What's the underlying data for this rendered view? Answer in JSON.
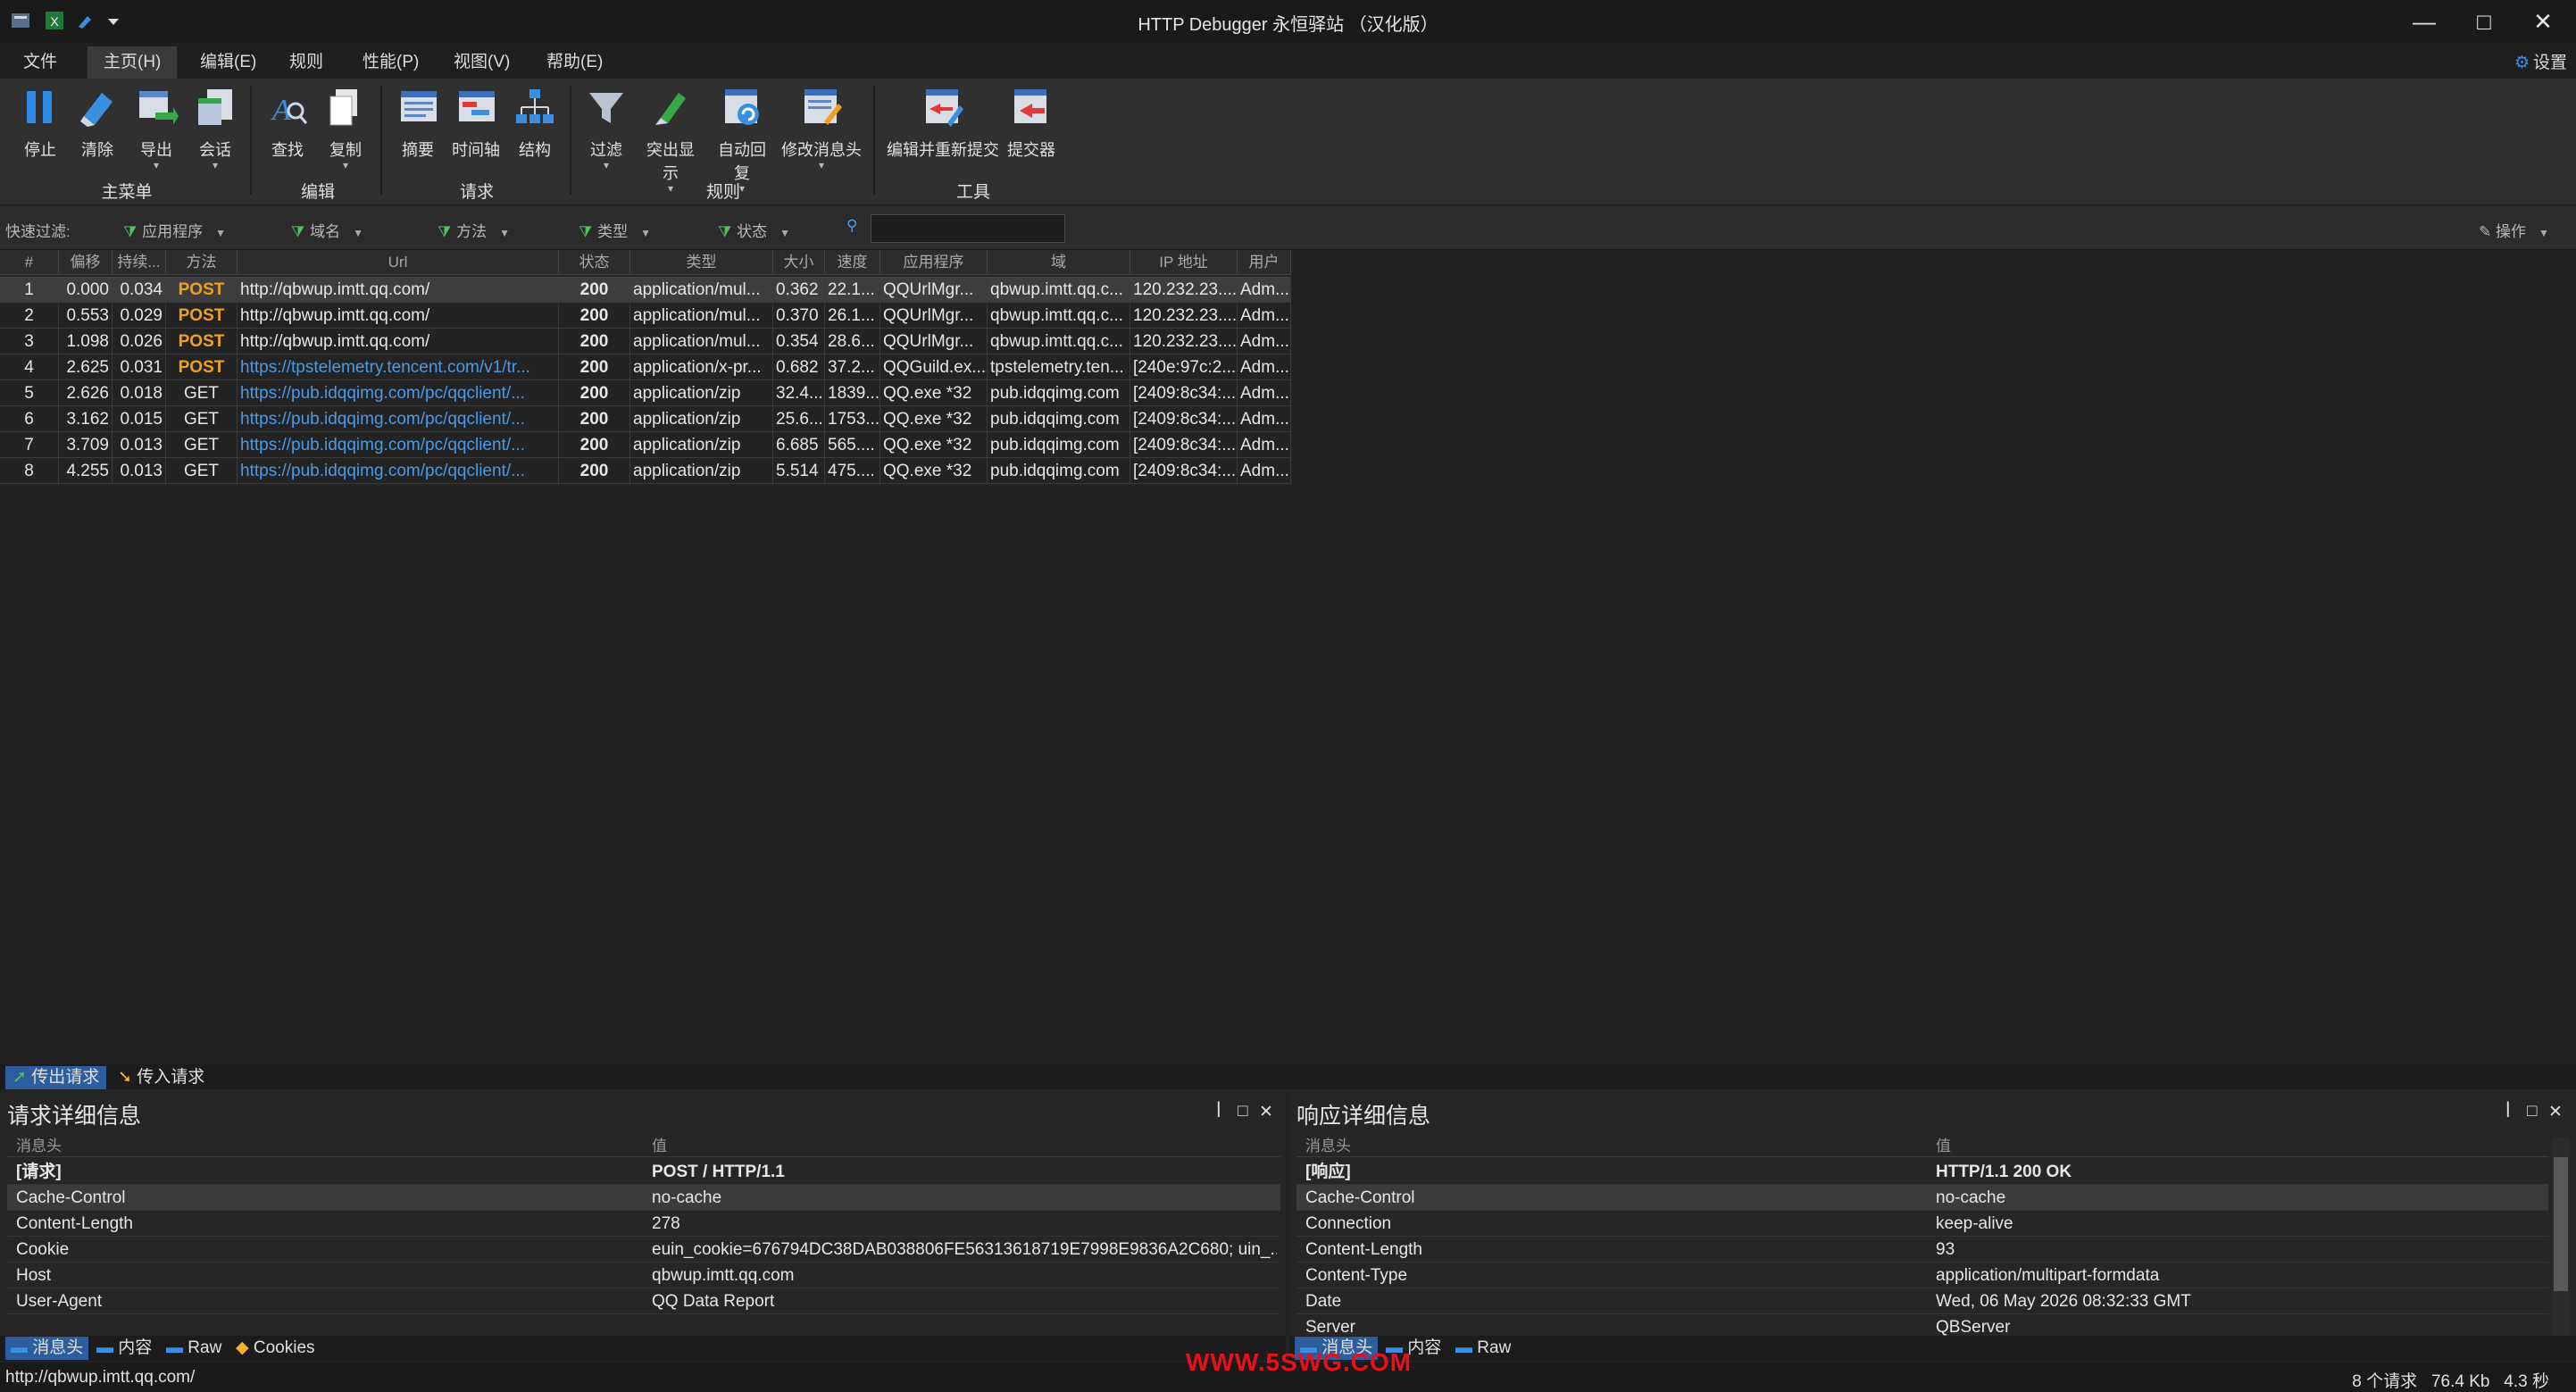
{
  "window": {
    "title": "HTTP Debugger 永恒驿站 （汉化版）",
    "minimize": "—",
    "maximize": "□",
    "close": "✕"
  },
  "menu": {
    "tabs": [
      "文件",
      "主页(H)",
      "编辑(E)",
      "规则",
      "性能(P)",
      "视图(V)",
      "帮助(E)"
    ],
    "active": "主页(H)",
    "settings": "设置"
  },
  "ribbon": {
    "buttons": {
      "stop": "停止",
      "clear": "清除",
      "export": "导出",
      "session": "会话",
      "find": "查找",
      "copy": "复制",
      "summary": "摘要",
      "timeline": "时间轴",
      "structure": "结构",
      "filter": "过滤",
      "highlight": "突出显示",
      "autoreply": "自动回复",
      "modify_headers": "修改消息头",
      "edit_resubmit": "编辑并重新提交",
      "submitter": "提交器"
    },
    "groups": {
      "main": "主菜单",
      "edit": "编辑",
      "request": "请求",
      "rules": "规则",
      "tools": "工具"
    }
  },
  "filterbar": {
    "label": "快速过滤:",
    "app": "应用程序",
    "domain": "域名",
    "method": "方法",
    "type": "类型",
    "status": "状态",
    "search_value": "",
    "operations": "操作"
  },
  "grid": {
    "columns": [
      "#",
      "偏移",
      "持续...",
      "方法",
      "Url",
      "状态",
      "类型",
      "大小",
      "速度",
      "应用程序",
      "域",
      "IP 地址",
      "用户"
    ],
    "rows": [
      {
        "n": "1",
        "offset": "0.000",
        "dur": "0.034",
        "method": "POST",
        "url": "http://qbwup.imtt.qq.com/",
        "status": "200",
        "type": "application/mul...",
        "size": "0.362",
        "speed": "22.1...",
        "app": "QQUrlMgr...",
        "domain": "qbwup.imtt.qq.c...",
        "ip": "120.232.23....",
        "user": "Adm..."
      },
      {
        "n": "2",
        "offset": "0.553",
        "dur": "0.029",
        "method": "POST",
        "url": "http://qbwup.imtt.qq.com/",
        "status": "200",
        "type": "application/mul...",
        "size": "0.370",
        "speed": "26.1...",
        "app": "QQUrlMgr...",
        "domain": "qbwup.imtt.qq.c...",
        "ip": "120.232.23....",
        "user": "Adm..."
      },
      {
        "n": "3",
        "offset": "1.098",
        "dur": "0.026",
        "method": "POST",
        "url": "http://qbwup.imtt.qq.com/",
        "status": "200",
        "type": "application/mul...",
        "size": "0.354",
        "speed": "28.6...",
        "app": "QQUrlMgr...",
        "domain": "qbwup.imtt.qq.c...",
        "ip": "120.232.23....",
        "user": "Adm..."
      },
      {
        "n": "4",
        "offset": "2.625",
        "dur": "0.031",
        "method": "POST",
        "url": "https://tpstelemetry.tencent.com/v1/tr...",
        "status": "200",
        "type": "application/x-pr...",
        "size": "0.682",
        "speed": "37.2...",
        "app": "QQGuild.ex...",
        "domain": "tpstelemetry.ten...",
        "ip": "[240e:97c:2...",
        "user": "Adm..."
      },
      {
        "n": "5",
        "offset": "2.626",
        "dur": "0.018",
        "method": "GET",
        "url": "https://pub.idqqimg.com/pc/qqclient/...",
        "status": "200",
        "type": "application/zip",
        "size": "32.4...",
        "speed": "1839...",
        "app": "QQ.exe *32",
        "domain": "pub.idqqimg.com",
        "ip": "[2409:8c34:...",
        "user": "Adm..."
      },
      {
        "n": "6",
        "offset": "3.162",
        "dur": "0.015",
        "method": "GET",
        "url": "https://pub.idqqimg.com/pc/qqclient/...",
        "status": "200",
        "type": "application/zip",
        "size": "25.6...",
        "speed": "1753...",
        "app": "QQ.exe *32",
        "domain": "pub.idqqimg.com",
        "ip": "[2409:8c34:...",
        "user": "Adm..."
      },
      {
        "n": "7",
        "offset": "3.709",
        "dur": "0.013",
        "method": "GET",
        "url": "https://pub.idqqimg.com/pc/qqclient/...",
        "status": "200",
        "type": "application/zip",
        "size": "6.685",
        "speed": "565....",
        "app": "QQ.exe *32",
        "domain": "pub.idqqimg.com",
        "ip": "[2409:8c34:...",
        "user": "Adm..."
      },
      {
        "n": "8",
        "offset": "4.255",
        "dur": "0.013",
        "method": "GET",
        "url": "https://pub.idqqimg.com/pc/qqclient/...",
        "status": "200",
        "type": "application/zip",
        "size": "5.514",
        "speed": "475....",
        "app": "QQ.exe *32",
        "domain": "pub.idqqimg.com",
        "ip": "[2409:8c34:...",
        "user": "Adm..."
      }
    ]
  },
  "traffic_tabs": {
    "outgoing": "传出请求",
    "incoming": "传入请求"
  },
  "request_panel": {
    "title": "请求详细信息",
    "col_key": "消息头",
    "col_value": "值",
    "rows": [
      {
        "k": "[请求]",
        "v": "POST / HTTP/1.1"
      },
      {
        "k": "Cache-Control",
        "v": "no-cache"
      },
      {
        "k": "Content-Length",
        "v": "278"
      },
      {
        "k": "Cookie",
        "v": "euin_cookie=676794DC38DAB038806FE56313618719E7998E9836A2C680; uin_..."
      },
      {
        "k": "Host",
        "v": "qbwup.imtt.qq.com"
      },
      {
        "k": "User-Agent",
        "v": "QQ Data Report"
      }
    ],
    "tabs": [
      "消息头",
      "内容",
      "Raw",
      "Cookies"
    ]
  },
  "response_panel": {
    "title": "响应详细信息",
    "col_key": "消息头",
    "col_value": "值",
    "rows": [
      {
        "k": "[响应]",
        "v": "HTTP/1.1 200 OK"
      },
      {
        "k": "Cache-Control",
        "v": "no-cache"
      },
      {
        "k": "Connection",
        "v": "keep-alive"
      },
      {
        "k": "Content-Length",
        "v": "93"
      },
      {
        "k": "Content-Type",
        "v": "application/multipart-formdata"
      },
      {
        "k": "Date",
        "v": "Wed, 06 May 2026 08:32:33 GMT"
      },
      {
        "k": "Server",
        "v": "QBServer"
      }
    ],
    "tabs": [
      "消息头",
      "内容",
      "Raw"
    ]
  },
  "panel_controls": {
    "pin": "ꟾ",
    "max": "□",
    "close": "✕"
  },
  "statusbar": {
    "url": "http://qbwup.imtt.qq.com/",
    "watermark": "WWW.5SWG.COM",
    "requests": "8 个请求",
    "size": "76.4 Kb",
    "time": "4.3 秒"
  },
  "colors": {
    "accent": "#2e5d9e",
    "post_method": "#f0a020",
    "link": "#4a9ae8",
    "watermark": "#e8101a"
  }
}
